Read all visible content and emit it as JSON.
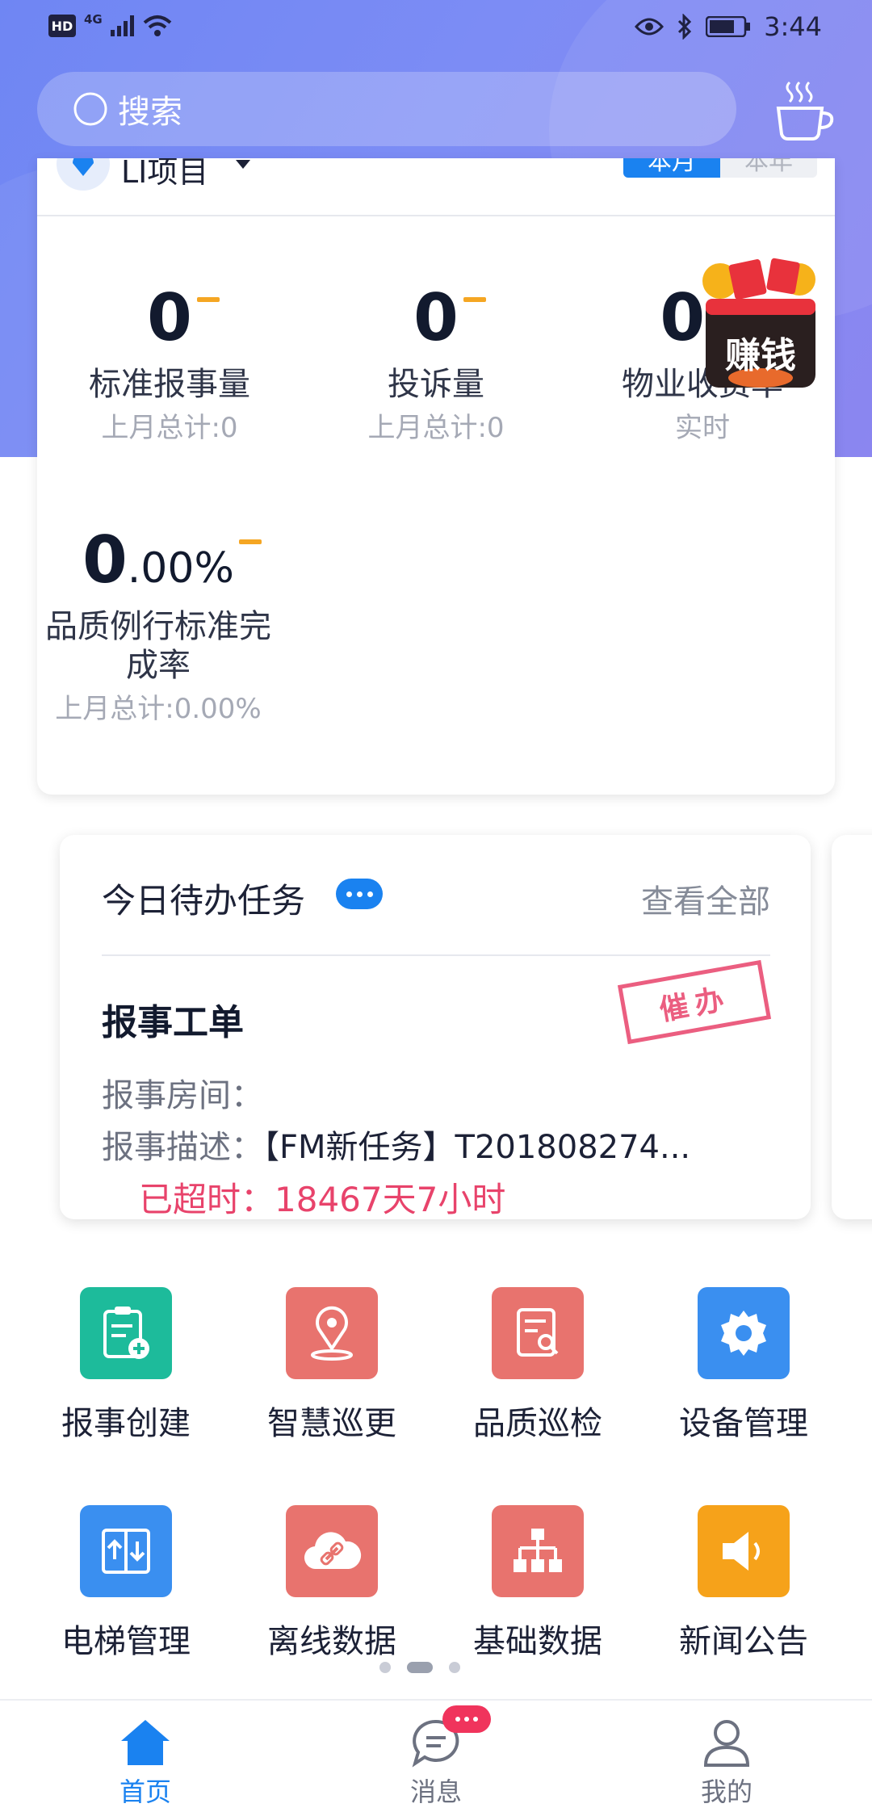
{
  "status": {
    "network": "4G",
    "hd": "HD",
    "time": "3:44"
  },
  "search": {
    "placeholder": "搜索"
  },
  "stats_card": {
    "project_name": "LI项目",
    "seg_month": "本月",
    "seg_year": "本年",
    "items": [
      {
        "value_main": "0",
        "value_small": "",
        "label": "标准报事量",
        "sub": "上月总计:0"
      },
      {
        "value_main": "0",
        "value_small": "",
        "label": "投诉量",
        "sub": "上月总计:0"
      },
      {
        "value_main": "0",
        "value_small": ".0",
        "label": "物业收费率",
        "sub": "实时"
      },
      {
        "value_main": "0",
        "value_small": ".00%",
        "label": "品质例行标准完成率",
        "label_line1": "品质例行标准完",
        "label_line2": "成率",
        "sub": "上月总计:0.00%"
      }
    ]
  },
  "money_badge": {
    "text": "赚钱"
  },
  "todo": {
    "title": "今日待办任务",
    "view_all": "查看全部",
    "kind": "报事工单",
    "stamp": "催办",
    "room_label": "报事房间：",
    "room_value": "",
    "desc_label": "报事描述：",
    "desc_value": "【FM新任务】T201808274...",
    "overdue": "已超时：18467天7小时"
  },
  "grid": [
    {
      "label": "报事创建",
      "icon": "clipboard-add-icon",
      "color": "#1dbb9b"
    },
    {
      "label": "智慧巡更",
      "icon": "location-pin-icon",
      "color": "#e8736e"
    },
    {
      "label": "品质巡检",
      "icon": "document-search-icon",
      "color": "#e8736e"
    },
    {
      "label": "设备管理",
      "icon": "gear-icon",
      "color": "#3a8ff0"
    },
    {
      "label": "电梯管理",
      "icon": "elevator-icon",
      "color": "#3a8ff0"
    },
    {
      "label": "离线数据",
      "icon": "cloud-link-icon",
      "color": "#e8736e"
    },
    {
      "label": "基础数据",
      "icon": "hierarchy-icon",
      "color": "#e8736e"
    },
    {
      "label": "新闻公告",
      "icon": "speaker-icon",
      "color": "#f6a21a"
    }
  ],
  "nav": [
    {
      "label": "首页",
      "icon": "home-icon"
    },
    {
      "label": "消息",
      "icon": "message-icon"
    },
    {
      "label": "我的",
      "icon": "user-icon"
    }
  ],
  "colors": {
    "accent": "#1a82f0",
    "alert": "#e8436b",
    "dash": "#f5a623"
  }
}
